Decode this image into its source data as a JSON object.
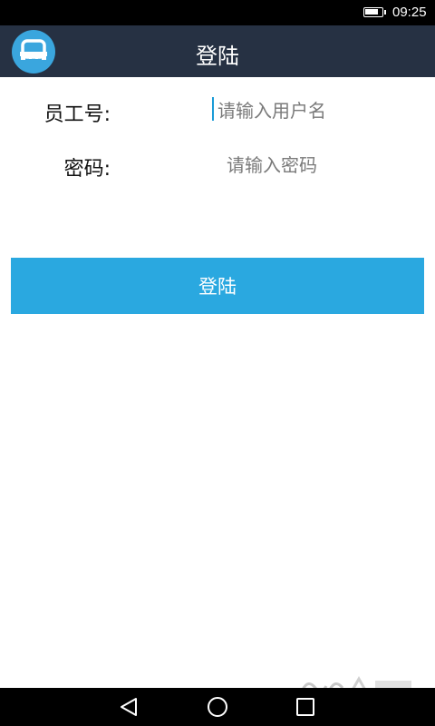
{
  "status_bar": {
    "time": "09:25",
    "battery_icon": "battery-icon"
  },
  "app_bar": {
    "title": "登陆",
    "logo_icon": "app-logo-icon",
    "logo_color": "#3aa6de",
    "background": "#263143"
  },
  "form": {
    "employee_id": {
      "label": "员工号:",
      "placeholder": "请输入用户名",
      "value": ""
    },
    "password": {
      "label": "密码:",
      "placeholder": "请输入密码",
      "value": ""
    }
  },
  "login_button": {
    "label": "登陆",
    "color": "#2aa8e0"
  },
  "nav_bar": {
    "back_icon": "back-triangle-icon",
    "home_icon": "home-circle-icon",
    "recents_icon": "recents-square-icon"
  }
}
